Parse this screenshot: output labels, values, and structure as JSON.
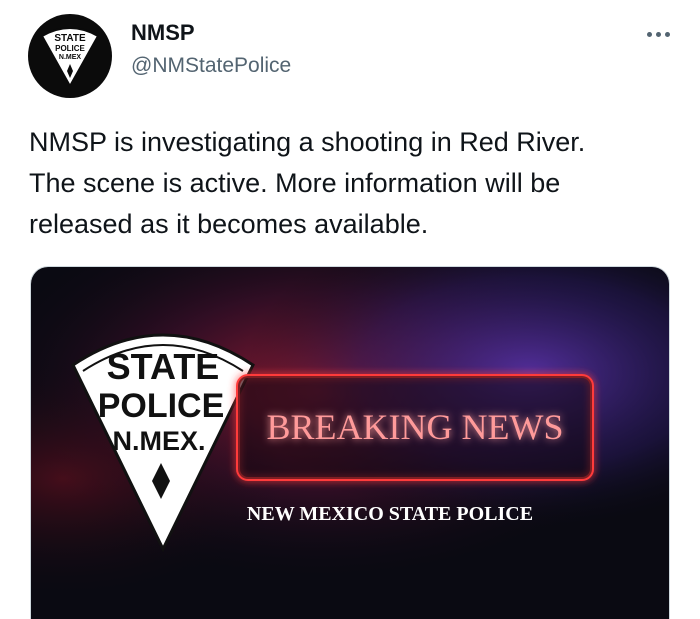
{
  "author": {
    "name": "NMSP",
    "handle": "@NMStatePolice",
    "avatar_badge": [
      "STATE",
      "POLICE",
      "N.MEX"
    ]
  },
  "tweet": {
    "text": "NMSP is investigating a shooting in Red River.\nThe scene is active.  More information will be\nreleased as it becomes available."
  },
  "media": {
    "badge_line1": "STATE",
    "badge_line2": "POLICE",
    "badge_line3": "N.MEX.",
    "headline": "BREAKING NEWS",
    "subheadline": "NEW MEXICO STATE POLICE"
  },
  "icons": {
    "more": "more-horizontal-icon",
    "avatar": "state-police-badge-icon"
  },
  "colors": {
    "text_primary": "#0f1419",
    "text_secondary": "#536471",
    "neon_red": "#ff3a3a",
    "media_bg": "#0a0a12"
  }
}
